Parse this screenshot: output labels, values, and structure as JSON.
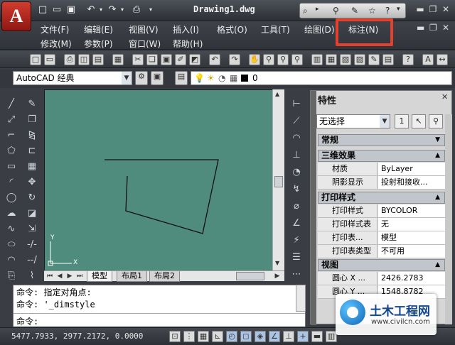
{
  "app": {
    "logo_letter": "A",
    "document_title": "Drawing1.dwg"
  },
  "menu": {
    "row1": [
      "文件(F)",
      "编辑(E)",
      "视图(V)",
      "插入(I)",
      "格式(O)",
      "工具(T)",
      "绘图(D)",
      "标注(N)"
    ],
    "row2": [
      "修改(M)",
      "参数(P)",
      "窗口(W)",
      "帮助(H)"
    ],
    "highlighted": "标注(N)"
  },
  "workspace": {
    "selected": "AutoCAD 经典"
  },
  "layer": {
    "current": "0"
  },
  "drawing": {
    "axis_y": "Y",
    "axis_x": "X",
    "background_color": "#4f8c7e"
  },
  "layout_tabs": [
    "模型",
    "布局1",
    "布局2"
  ],
  "properties": {
    "title": "特性",
    "selection": "无选择",
    "sections": {
      "general": "常规",
      "3d_effects": "三维效果",
      "plot_style": "打印样式",
      "view": "视图"
    },
    "rows_3d": [
      {
        "key": "材质",
        "value": "ByLayer"
      },
      {
        "key": "阴影显示",
        "value": "投射和接收..."
      }
    ],
    "rows_plot": [
      {
        "key": "打印样式",
        "value": "BYCOLOR"
      },
      {
        "key": "打印样式表",
        "value": "无"
      },
      {
        "key": "打印表...",
        "value": "模型"
      },
      {
        "key": "打印表类型",
        "value": "不可用"
      }
    ],
    "rows_view": [
      {
        "key": "圆心 X ...",
        "value": "2426.2783"
      },
      {
        "key": "圆心 Y ...",
        "value": "1548.8782"
      }
    ]
  },
  "command": {
    "line1": "命令: 指定对角点:",
    "line2": "命令: '_dimstyle",
    "prompt": "命令:"
  },
  "status": {
    "coordinates": "5477.7933, 2977.2172, 0.0000"
  },
  "watermark": {
    "title": "土木工程网",
    "url": "www.civilcn.com"
  },
  "colors": {
    "highlight": "#e2412e",
    "canvas": "#4f8c7e",
    "logo_red": "#d23b2e"
  }
}
